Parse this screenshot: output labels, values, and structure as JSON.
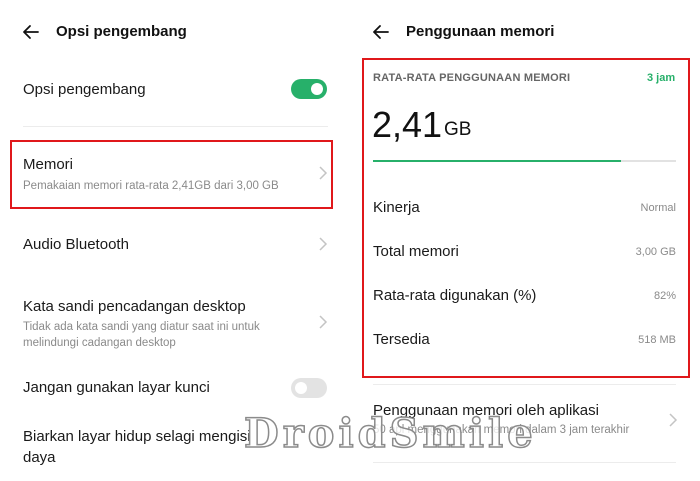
{
  "left": {
    "title": "Opsi pengembang",
    "items": [
      {
        "label": "Opsi pengembang",
        "toggle": "on"
      },
      {
        "label": "Memori",
        "desc": "Pemakaian memori rata-rata 2,41GB dari 3,00 GB"
      },
      {
        "label": "Audio Bluetooth"
      },
      {
        "label": "Kata sandi pencadangan desktop",
        "desc_line1": "Tidak ada kata sandi yang diatur saat ini untuk",
        "desc_line2": "melindungi cadangan desktop"
      },
      {
        "label": "Jangan gunakan layar kunci",
        "toggle": "off"
      },
      {
        "label_line1": "Biarkan layar hidup selagi mengisi",
        "label_line2": "daya"
      }
    ]
  },
  "right": {
    "title": "Penggunaan memori",
    "section_title": "RATA-RATA PENGGUNAAN MEMORI",
    "time_range": "3 jam",
    "usage_value": "2,41",
    "usage_unit": "GB",
    "usage_fraction": 0.82,
    "stats": [
      {
        "label": "Kinerja",
        "value": "Normal"
      },
      {
        "label": "Total memori",
        "value": "3,00 GB"
      },
      {
        "label": "Rata-rata digunakan (%)",
        "value": "82%"
      },
      {
        "label": "Tersedia",
        "value": "518 MB"
      }
    ],
    "app_usage_label": "Penggunaan memori oleh aplikasi",
    "app_usage_desc": "50 apl menggunakan memori dalam 3 jam terakhir"
  },
  "watermark": "DroidSmile",
  "colors": {
    "accent": "#27b06a",
    "highlight": "#e0181b"
  }
}
